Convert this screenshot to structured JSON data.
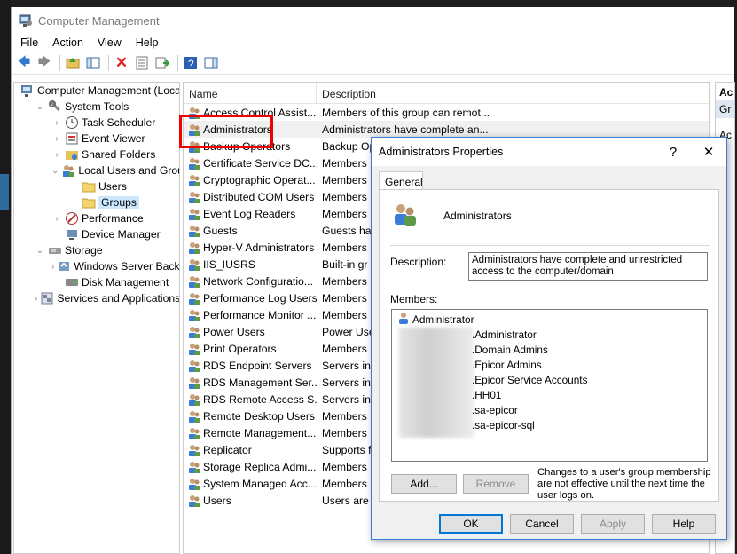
{
  "window": {
    "title": "Computer Management"
  },
  "menu": [
    "File",
    "Action",
    "View",
    "Help"
  ],
  "toolbar_icons": [
    "back-arrow-icon",
    "forward-arrow-icon",
    "up-folder-icon",
    "show-hide-tree-icon",
    "delete-icon",
    "properties-icon",
    "export-list-icon",
    "help-icon",
    "show-hide-action-pane-icon"
  ],
  "tree": [
    {
      "label": "Computer Management (Local",
      "indent": 0,
      "arrow": "",
      "icon": "computer-management-icon"
    },
    {
      "label": "System Tools",
      "indent": 1,
      "arrow": "v",
      "icon": "tools-icon"
    },
    {
      "label": "Task Scheduler",
      "indent": 2,
      "arrow": ">",
      "icon": "clock-icon"
    },
    {
      "label": "Event Viewer",
      "indent": 2,
      "arrow": ">",
      "icon": "event-viewer-icon"
    },
    {
      "label": "Shared Folders",
      "indent": 2,
      "arrow": ">",
      "icon": "shared-folder-icon"
    },
    {
      "label": "Local Users and Groups",
      "indent": 2,
      "arrow": "v",
      "icon": "users-icon"
    },
    {
      "label": "Users",
      "indent": 3,
      "arrow": "",
      "icon": "folder-icon"
    },
    {
      "label": "Groups",
      "indent": 3,
      "arrow": "",
      "icon": "folder-icon",
      "selected": true
    },
    {
      "label": "Performance",
      "indent": 2,
      "arrow": ">",
      "icon": "performance-icon"
    },
    {
      "label": "Device Manager",
      "indent": 2,
      "arrow": "",
      "icon": "device-manager-icon"
    },
    {
      "label": "Storage",
      "indent": 1,
      "arrow": "v",
      "icon": "storage-icon"
    },
    {
      "label": "Windows Server Backup",
      "indent": 2,
      "arrow": ">",
      "icon": "backup-icon"
    },
    {
      "label": "Disk Management",
      "indent": 2,
      "arrow": "",
      "icon": "disk-icon"
    },
    {
      "label": "Services and Applications",
      "indent": 1,
      "arrow": ">",
      "icon": "services-icon"
    }
  ],
  "list": {
    "col_name": "Name",
    "col_desc": "Description",
    "rows": [
      {
        "name": "Access Control Assist...",
        "desc": "Members of this group can remot..."
      },
      {
        "name": "Administrators",
        "desc": "Administrators have complete an...",
        "highlight": true
      },
      {
        "name": "Backup Operators",
        "desc": "Backup Op"
      },
      {
        "name": "Certificate Service DC...",
        "desc": "Members"
      },
      {
        "name": "Cryptographic Operat...",
        "desc": "Members"
      },
      {
        "name": "Distributed COM Users",
        "desc": "Members"
      },
      {
        "name": "Event Log Readers",
        "desc": "Members"
      },
      {
        "name": "Guests",
        "desc": "Guests hav"
      },
      {
        "name": "Hyper-V Administrators",
        "desc": "Members"
      },
      {
        "name": "IIS_IUSRS",
        "desc": "Built-in gr"
      },
      {
        "name": "Network Configuratio...",
        "desc": "Members"
      },
      {
        "name": "Performance Log Users",
        "desc": "Members"
      },
      {
        "name": "Performance Monitor ...",
        "desc": "Members"
      },
      {
        "name": "Power Users",
        "desc": "Power Use"
      },
      {
        "name": "Print Operators",
        "desc": "Members"
      },
      {
        "name": "RDS Endpoint Servers",
        "desc": "Servers in"
      },
      {
        "name": "RDS Management Ser...",
        "desc": "Servers in"
      },
      {
        "name": "RDS Remote Access S...",
        "desc": "Servers in"
      },
      {
        "name": "Remote Desktop Users",
        "desc": "Members"
      },
      {
        "name": "Remote Management...",
        "desc": "Members"
      },
      {
        "name": "Replicator",
        "desc": "Supports f"
      },
      {
        "name": "Storage Replica Admi...",
        "desc": "Members"
      },
      {
        "name": "System Managed Acc...",
        "desc": "Members"
      },
      {
        "name": "Users",
        "desc": "Users are p"
      }
    ]
  },
  "actions": {
    "header": "Ac",
    "item": "Gr",
    "item2": "Ac"
  },
  "dialog": {
    "title": "Administrators Properties",
    "help_glyph": "?",
    "close_glyph": "✕",
    "tab": "General",
    "group_name": "Administrators",
    "description_label": "Description:",
    "description_value": "Administrators have complete and unrestricted access to the computer/domain",
    "members_label": "Members:",
    "members": [
      "Administrator",
      ".Administrator",
      ".Domain Admins",
      ".Epicor Admins",
      ".Epicor Service Accounts",
      ".HH01",
      ".sa-epicor",
      ".sa-epicor-sql"
    ],
    "note": "Changes to a user's group membership are not effective until the next time the user logs on.",
    "add": "Add...",
    "remove": "Remove",
    "ok": "OK",
    "cancel": "Cancel",
    "apply": "Apply",
    "help": "Help"
  }
}
